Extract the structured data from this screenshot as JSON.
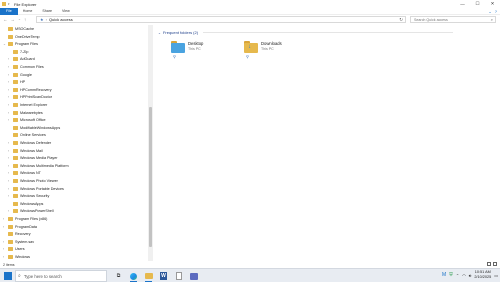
{
  "window": {
    "title": "File Explorer",
    "controls": {
      "minimize": "—",
      "maximize": "☐",
      "close": "✕"
    }
  },
  "ribbon": {
    "tabs": [
      "File",
      "Home",
      "Share",
      "View"
    ]
  },
  "address": {
    "path": "Quick access",
    "search_placeholder": "Search Quick access"
  },
  "nav": {
    "items": [
      {
        "label": "MSOCache",
        "indent": 1,
        "icon": "folder",
        "chevron": ""
      },
      {
        "label": "OneDriveTemp",
        "indent": 1,
        "icon": "folder",
        "chevron": ""
      },
      {
        "label": "Program Files",
        "indent": 1,
        "icon": "folder",
        "chevron": "v"
      },
      {
        "label": "7-Zip",
        "indent": 2,
        "icon": "folder",
        "chevron": ""
      },
      {
        "label": "AdGuard",
        "indent": 2,
        "icon": "folder",
        "chevron": ">"
      },
      {
        "label": "Common Files",
        "indent": 2,
        "icon": "folder",
        "chevron": ">"
      },
      {
        "label": "Google",
        "indent": 2,
        "icon": "folder",
        "chevron": ">"
      },
      {
        "label": "HP",
        "indent": 2,
        "icon": "folder",
        "chevron": ">"
      },
      {
        "label": "HPCommRecovery",
        "indent": 2,
        "icon": "folder",
        "chevron": ">"
      },
      {
        "label": "HPPrintScanDoctor",
        "indent": 2,
        "icon": "folder",
        "chevron": ">"
      },
      {
        "label": "Internet Explorer",
        "indent": 2,
        "icon": "folder",
        "chevron": ">"
      },
      {
        "label": "Malwarebytes",
        "indent": 2,
        "icon": "folder",
        "chevron": ">"
      },
      {
        "label": "Microsoft Office",
        "indent": 2,
        "icon": "folder",
        "chevron": ">"
      },
      {
        "label": "ModifiableWindowsApps",
        "indent": 2,
        "icon": "folder",
        "chevron": ""
      },
      {
        "label": "Online Services",
        "indent": 2,
        "icon": "folder",
        "chevron": ""
      },
      {
        "label": "Windows Defender",
        "indent": 2,
        "icon": "folder",
        "chevron": ">"
      },
      {
        "label": "Windows Mail",
        "indent": 2,
        "icon": "folder",
        "chevron": ">"
      },
      {
        "label": "Windows Media Player",
        "indent": 2,
        "icon": "folder",
        "chevron": ">"
      },
      {
        "label": "Windows Multimedia Platform",
        "indent": 2,
        "icon": "folder",
        "chevron": ">"
      },
      {
        "label": "Windows NT",
        "indent": 2,
        "icon": "folder",
        "chevron": ">"
      },
      {
        "label": "Windows Photo Viewer",
        "indent": 2,
        "icon": "folder",
        "chevron": ">"
      },
      {
        "label": "Windows Portable Devices",
        "indent": 2,
        "icon": "folder",
        "chevron": ">"
      },
      {
        "label": "Windows Security",
        "indent": 2,
        "icon": "folder",
        "chevron": ">"
      },
      {
        "label": "WindowsApps",
        "indent": 2,
        "icon": "folder",
        "chevron": ""
      },
      {
        "label": "WindowsPowerShell",
        "indent": 2,
        "icon": "folder",
        "chevron": ">"
      },
      {
        "label": "Program Files (x86)",
        "indent": 1,
        "icon": "folder",
        "chevron": ">"
      },
      {
        "label": "ProgramData",
        "indent": 1,
        "icon": "folder",
        "chevron": ">"
      },
      {
        "label": "Recovery",
        "indent": 1,
        "icon": "folder",
        "chevron": ""
      },
      {
        "label": "System.sav",
        "indent": 1,
        "icon": "folder",
        "chevron": ">"
      },
      {
        "label": "Users",
        "indent": 1,
        "icon": "folder",
        "chevron": ">"
      },
      {
        "label": "Windows",
        "indent": 1,
        "icon": "folder",
        "chevron": ">"
      }
    ]
  },
  "content": {
    "group_header": "Frequent folders (2)",
    "tiles": [
      {
        "name": "Desktop",
        "sub": "This PC",
        "icon": "desktop-folder"
      },
      {
        "name": "Downloads",
        "sub": "This PC",
        "icon": "downloads-folder"
      }
    ]
  },
  "status": {
    "items_text": "2 items"
  },
  "taskbar": {
    "search_placeholder": "Type here to search",
    "time": "10:51 AM",
    "date": "2/10/2025"
  },
  "colors": {
    "accent": "#1a73c9",
    "folder": "#e6b94d"
  }
}
